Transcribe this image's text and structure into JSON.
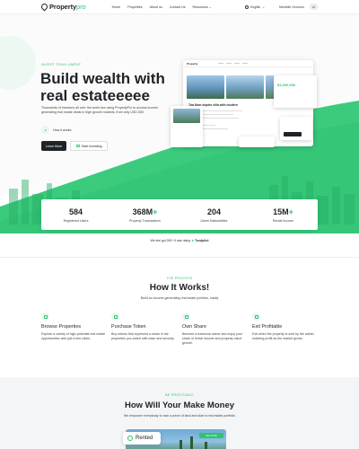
{
  "nav": {
    "brand_main": "Property",
    "brand_accent": "pro",
    "links": [
      "Home",
      "Properties",
      "About us",
      "Contact Us",
      "Resources"
    ],
    "language": "English",
    "user_name": "Michelle Oconnor",
    "avatar_initials": "M"
  },
  "hero": {
    "eyebrow": "INVEST TOKAL AMENT",
    "title": "Build wealth with real estateeeee",
    "subtitle": "Thousands of investors all over the world are using PropertyPro to access income generating real estate deals in high growth markets. from only USD 500.",
    "how_it_works": "How it works",
    "learn_more": "Learn More",
    "start_investing": "Start Investing",
    "mockup": {
      "brand": "Property",
      "listing_title": "Top floor duplex villa with modern",
      "price": "$1,000,000"
    }
  },
  "stats": [
    {
      "value": "584",
      "suffix": "",
      "label": "Registered Users"
    },
    {
      "value": "368M",
      "suffix": "+",
      "label": "Property Transactions"
    },
    {
      "value": "204",
      "suffix": "",
      "label": "Users Nationalities"
    },
    {
      "value": "15M",
      "suffix": "+",
      "label": "Rental Income"
    }
  ],
  "trust": {
    "text": "We feel got 280+ 5 star rating",
    "brand": "Trustpilot"
  },
  "how": {
    "eyebrow": "THE PROCESS",
    "title": "How It Works!",
    "subtitle": "Build an income-generating real estate portfolio, easily",
    "steps": [
      {
        "title": "Browse Properties",
        "desc": "Explore a variety of high-potential real estate opportunities with just a few clicks."
      },
      {
        "title": "Purchase Token",
        "desc": "Buy tokens that represent a share in the properties you select with ease and security."
      },
      {
        "title": "Own Share",
        "desc": "Become a fractional owner and enjoy your share of rental income and property value growth."
      },
      {
        "title": "Exit Profitable",
        "desc": "Exit when the property is sold by the admin, realizing profit as the market grows."
      }
    ]
  },
  "money": {
    "eyebrow": "BE PROFITABLE",
    "title": "How Will Your Make Money",
    "subtitle": "We empower everybody to own a piece of land and start a real estate portfolio",
    "rented_label": "Rented",
    "tag_label": "Net Profit"
  },
  "colors": {
    "accent": "#2fc374",
    "dark": "#1f2328"
  }
}
